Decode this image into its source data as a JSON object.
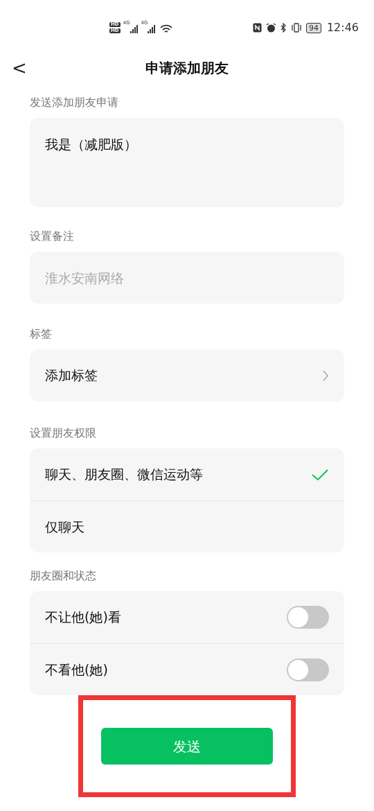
{
  "status_bar": {
    "sim_labels": [
      "HD",
      "HD"
    ],
    "network_labels": [
      "4G",
      "4G"
    ],
    "battery": "94",
    "time": "12:46"
  },
  "header": {
    "back": "<",
    "title": "申请添加朋友"
  },
  "request": {
    "label": "发送添加朋友申请",
    "value": "我是（减肥版）"
  },
  "remark": {
    "label": "设置备注",
    "placeholder": "淮水安南网络"
  },
  "tags": {
    "label": "标签",
    "item": "添加标签"
  },
  "permissions": {
    "label": "设置朋友权限",
    "options": [
      {
        "label": "聊天、朋友圈、微信运动等",
        "selected": true
      },
      {
        "label": "仅聊天",
        "selected": false
      }
    ]
  },
  "moments": {
    "label": "朋友圈和状态",
    "toggles": [
      {
        "label": "不让他(她)看",
        "on": false
      },
      {
        "label": "不看他(她)",
        "on": false
      }
    ]
  },
  "send_button": {
    "label": "发送",
    "highlighted": true
  }
}
